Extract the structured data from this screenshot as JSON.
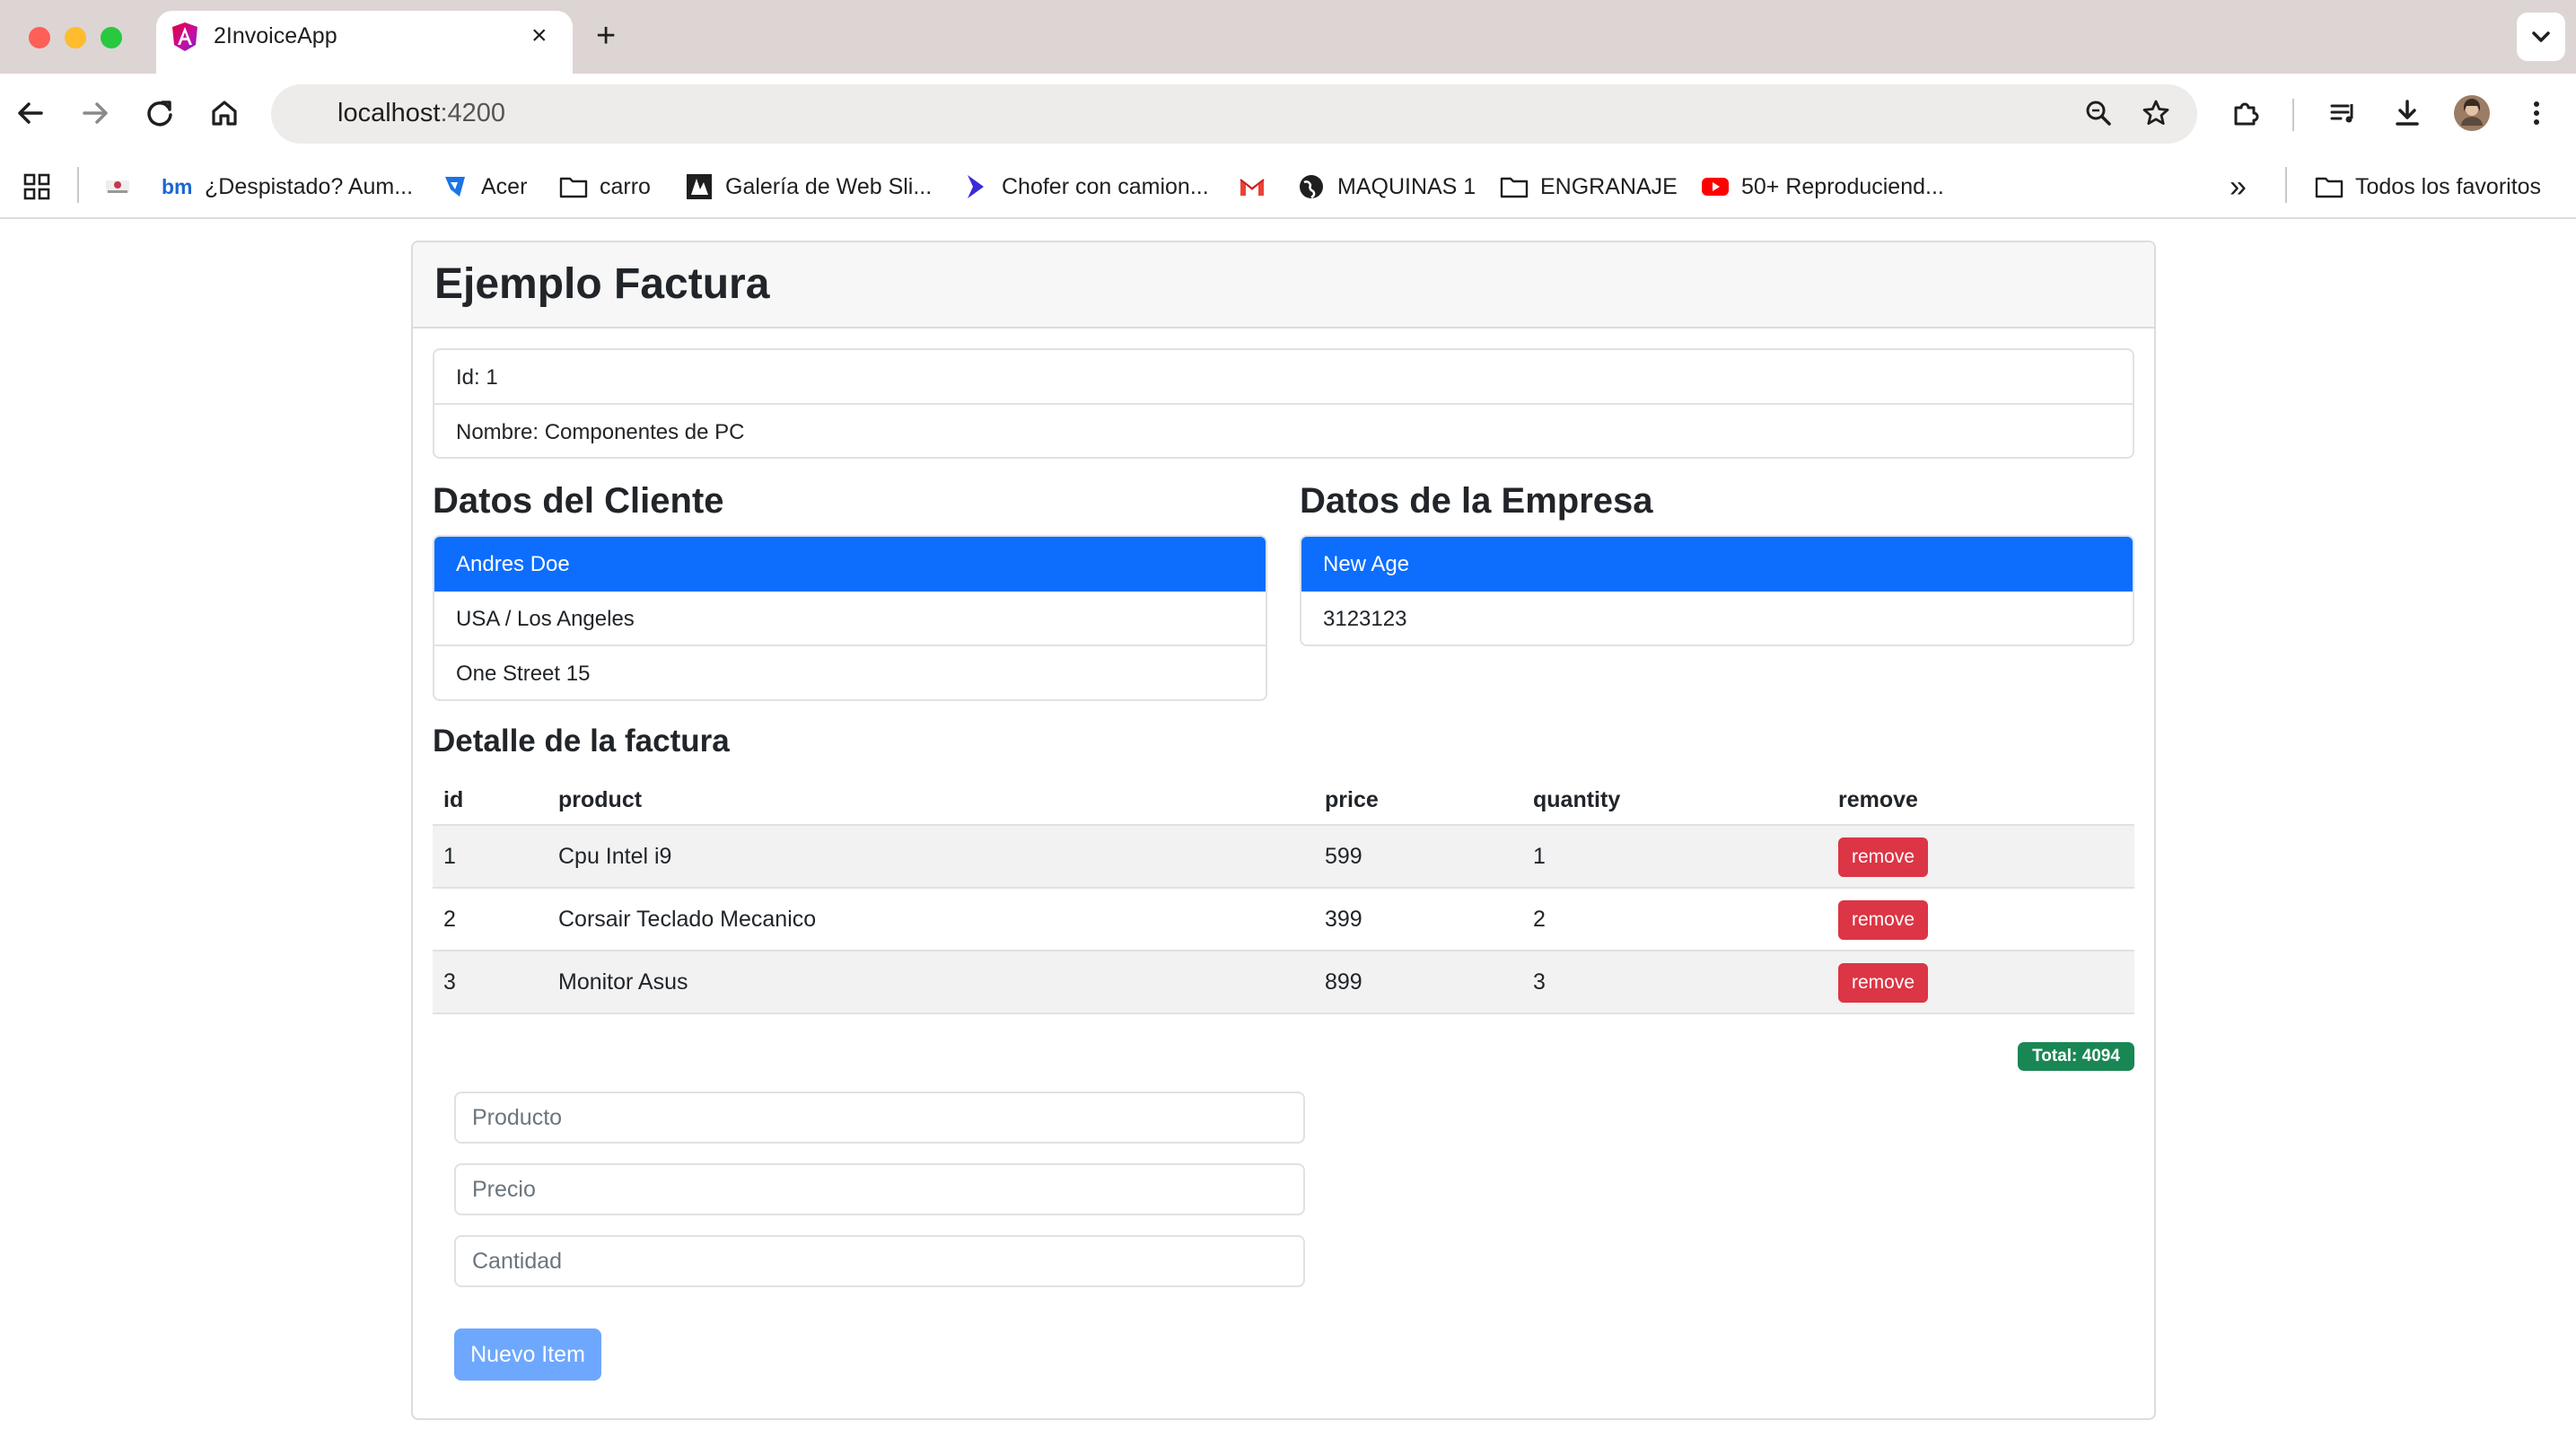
{
  "browser": {
    "tab_title": "2InvoiceApp",
    "tab_close": "×",
    "new_tab": "+",
    "url_host": "localhost",
    "url_port": ":4200",
    "bookmarks": [
      {
        "label": "",
        "icon": "apps-grid-icon"
      },
      {
        "label": "",
        "icon": "site-logo-icon"
      },
      {
        "label": "¿Despistado? Aum...",
        "icon": "bm-logo-icon"
      },
      {
        "label": "Acer",
        "icon": "acer-icon"
      },
      {
        "label": "carro",
        "icon": "folder-icon"
      },
      {
        "label": "Galería de Web Sli...",
        "icon": "web-slice-icon"
      },
      {
        "label": "Chofer con camion...",
        "icon": "chevron-logo-icon"
      },
      {
        "label": "",
        "icon": "gmail-icon"
      },
      {
        "label": "MAQUINAS 1",
        "icon": "globe-icon"
      },
      {
        "label": "ENGRANAJE",
        "icon": "folder-icon"
      },
      {
        "label": "50+ Reproduciend...",
        "icon": "youtube-icon"
      },
      {
        "label": "Todos los favoritos",
        "icon": "folder-icon"
      }
    ],
    "more_bookmarks": "»"
  },
  "invoice": {
    "title": "Ejemplo Factura",
    "id_line": "Id: 1",
    "name_line": "Nombre: Componentes de PC"
  },
  "client": {
    "heading": "Datos del Cliente",
    "name": "Andres Doe",
    "location": "USA / Los Angeles",
    "address": "One Street 15"
  },
  "company": {
    "heading": "Datos de la Empresa",
    "name": "New Age",
    "number": "3123123"
  },
  "detail": {
    "heading": "Detalle de la factura",
    "columns": [
      "id",
      "product",
      "price",
      "quantity",
      "remove"
    ],
    "rows": [
      {
        "id": "1",
        "product": "Cpu Intel i9",
        "price": "599",
        "quantity": "1",
        "action": "remove"
      },
      {
        "id": "2",
        "product": "Corsair Teclado Mecanico",
        "price": "399",
        "quantity": "2",
        "action": "remove"
      },
      {
        "id": "3",
        "product": "Monitor Asus",
        "price": "899",
        "quantity": "3",
        "action": "remove"
      }
    ],
    "total": "Total: 4094"
  },
  "form": {
    "product_placeholder": "Producto",
    "price_placeholder": "Precio",
    "quantity_placeholder": "Cantidad",
    "submit_label": "Nuevo Item"
  },
  "colors": {
    "primary": "#0d6efd",
    "danger": "#dc3545",
    "success": "#198754",
    "primary_disabled": "#6ea8fe"
  }
}
